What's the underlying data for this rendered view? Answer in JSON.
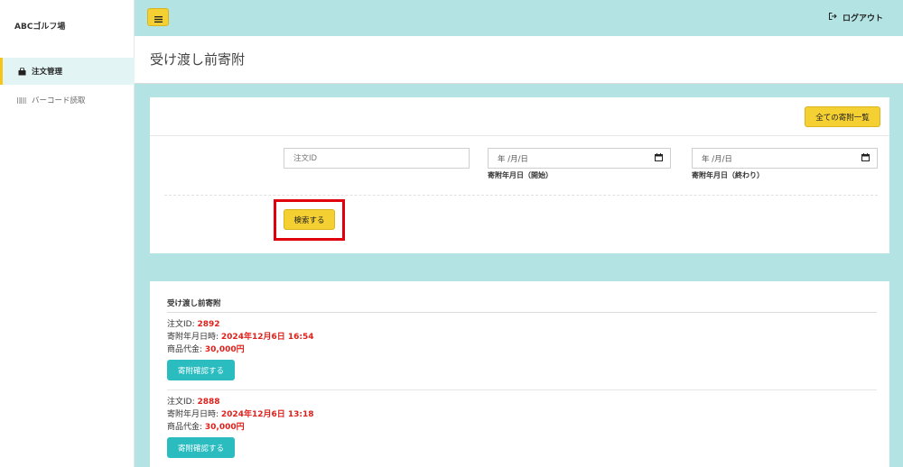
{
  "sidebar": {
    "brand": "ABCゴルフ場",
    "items": [
      {
        "label": "注文管理",
        "icon": "shopping-bag-icon",
        "active": true
      },
      {
        "label": "バーコード読取",
        "icon": "barcode-icon",
        "active": false
      }
    ]
  },
  "header": {
    "logout_label": "ログアウト"
  },
  "page": {
    "title": "受け渡し前寄附"
  },
  "search": {
    "all_button_label": "全ての寄附一覧",
    "order_id_placeholder": "注文ID",
    "date_start_value": "年 /月/日",
    "date_start_label": "寄附年月日（開始）",
    "date_end_value": "年 /月/日",
    "date_end_label": "寄附年月日（終わり）",
    "search_button_label": "検索する"
  },
  "results": {
    "title": "受け渡し前寄附",
    "orders": [
      {
        "id_label": "注文ID: ",
        "id": "2892",
        "date_label": "寄附年月日時: ",
        "date": "2024年12月6日 16:54",
        "price_label": "商品代金: ",
        "price": "30,000円",
        "button_label": "寄附確認する"
      },
      {
        "id_label": "注文ID: ",
        "id": "2888",
        "date_label": "寄附年月日時: ",
        "date": "2024年12月6日 13:18",
        "price_label": "商品代金: ",
        "price": "30,000円",
        "button_label": "寄附確認する"
      }
    ]
  },
  "colors": {
    "accent_yellow": "#f5d033",
    "teal_bg": "#b3e3e3",
    "button_teal": "#2bbcc0",
    "value_red": "#e0201b",
    "highlight_red": "#e0000d"
  }
}
